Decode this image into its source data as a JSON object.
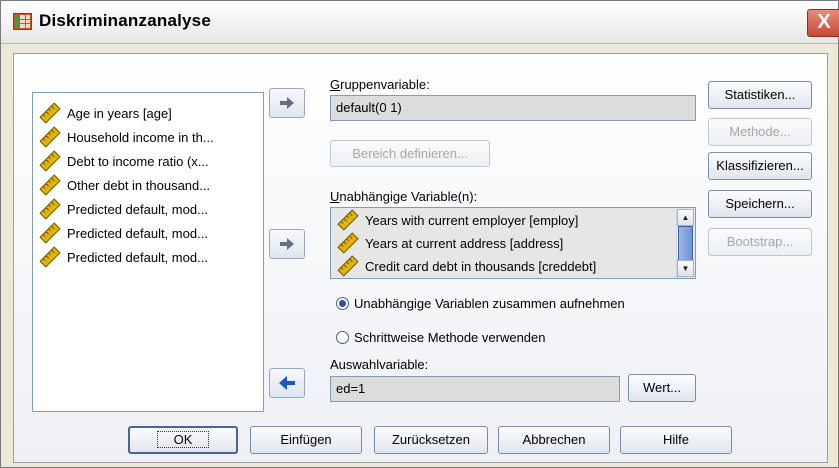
{
  "window": {
    "title": "Diskriminanzanalyse",
    "close_label": "X"
  },
  "source_list": {
    "items": [
      {
        "label": "Age in years [age]",
        "icon": "scale-ruler-icon"
      },
      {
        "label": "Household income in th...",
        "icon": "scale-ruler-icon"
      },
      {
        "label": "Debt to income ratio (x...",
        "icon": "scale-ruler-icon"
      },
      {
        "label": "Other debt in thousand...",
        "icon": "scale-ruler-icon"
      },
      {
        "label": "Predicted default, mod...",
        "icon": "scale-ruler-icon"
      },
      {
        "label": "Predicted default, mod...",
        "icon": "scale-ruler-icon"
      },
      {
        "label": "Predicted default, mod...",
        "icon": "scale-ruler-icon"
      }
    ]
  },
  "grouping": {
    "label": "Gruppenvariable:",
    "value": "default(0 1)",
    "define_range_label": "Bereich definieren..."
  },
  "independents": {
    "label": "Unabhängige Variable(n):",
    "items": [
      {
        "label": "Years with current employer [employ]",
        "icon": "scale-ruler-icon"
      },
      {
        "label": "Years at current address [address]",
        "icon": "scale-ruler-icon"
      },
      {
        "label": "Credit card debt in thousands [creddebt]",
        "icon": "scale-ruler-icon"
      }
    ]
  },
  "method_options": {
    "together_label": "Unabhängige Variablen zusammen aufnehmen",
    "stepwise_label": "Schrittweise Methode verwenden",
    "selected": "together"
  },
  "selection": {
    "label": "Auswahlvariable:",
    "value": "ed=1",
    "value_button_label": "Wert..."
  },
  "side_buttons": {
    "statistics": "Statistiken...",
    "method": "Methode...",
    "classify": "Klassifizieren...",
    "save": "Speichern...",
    "bootstrap": "Bootstrap..."
  },
  "bottom_buttons": {
    "ok": "OK",
    "paste": "Einfügen",
    "reset": "Zurücksetzen",
    "cancel": "Abbrechen",
    "help": "Hilfe"
  },
  "colors": {
    "accent": "#2a4fae",
    "arrow": "#1f55c2",
    "ruler": "#e2b400"
  }
}
